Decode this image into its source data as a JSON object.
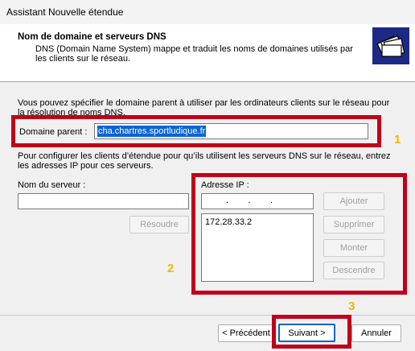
{
  "window": {
    "title": "Assistant Nouvelle étendue"
  },
  "header": {
    "title": "Nom de domaine et serveurs DNS",
    "description": "DNS (Domain Name System) mappe et traduit les noms de domaines utilisés par les clients sur le réseau."
  },
  "intro_text": "Vous pouvez spécifier le domaine parent à utiliser par les ordinateurs clients sur le réseau pour la résolution de noms DNS.",
  "parent_domain": {
    "label": "Domaine parent :",
    "value": "cha.chartres.sportludique.fr"
  },
  "dns_text": "Pour configurer les clients d’étendue pour qu’ils utilisent les serveurs DNS sur le réseau, entrez les adresses IP pour ces serveurs.",
  "server_name": {
    "label": "Nom du serveur :",
    "value": "",
    "resolve_button": "Résoudre"
  },
  "ip_address": {
    "label": "Adresse IP :",
    "field_value": ".        .        .",
    "list": [
      "172.28.33.2"
    ],
    "buttons": {
      "add": "Ajouter",
      "remove": "Supprimer",
      "up": "Monter",
      "down": "Descendre"
    }
  },
  "annotations": {
    "box1_number": "1",
    "box2_number": "2",
    "box3_number": "3",
    "accent_color": "#c0001a",
    "number_color": "#f5b400"
  },
  "footer": {
    "back": "< Précédent",
    "next": "Suivant >",
    "cancel": "Annuler"
  }
}
